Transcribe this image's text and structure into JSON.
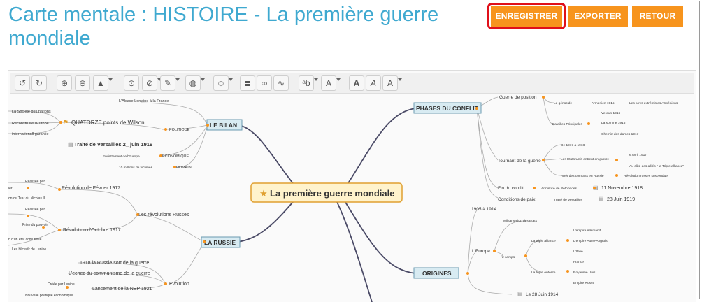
{
  "header": {
    "title": "Carte mentale : HISTOIRE - La première guerre mondiale",
    "save_label": "ENREGISTRER",
    "export_label": "EXPORTER",
    "back_label": "RETOUR"
  },
  "colors": {
    "accent": "#f7941d",
    "title": "#3fa9d0",
    "highlight": "#e0101a",
    "central_fill": "#fff3cc",
    "branch_fill": "#d8ebf2"
  },
  "toolbar": {
    "icons": [
      "undo-icon",
      "redo-icon",
      "zoom-in-icon",
      "zoom-out-icon",
      "shapes-icon",
      "topic-add-icon",
      "topic-remove-icon",
      "pen-color-icon",
      "palette-icon",
      "tag-icon",
      "note-icon",
      "link-icon",
      "relation-icon",
      "font-size-down-icon",
      "font-size-up-icon",
      "bold-icon",
      "italic-icon",
      "font-color-icon"
    ]
  },
  "mindmap": {
    "central": "La première guerre mondiale",
    "branches": {
      "bilan": "LE BILAN",
      "russie": "LA RUSSIE",
      "phases": "PHASES DU CONFLIT",
      "origines": "ORIGINES"
    },
    "bilan": {
      "alsace": "L'Alsace Lorraine à la France",
      "politique": "POLITIQUE",
      "quatorze": "QUATORZE points de Wilson",
      "sdn": "La Société des nations",
      "reconstruire": "Reconstruire l'Europe",
      "inter": "internationall garantie",
      "versailles": "Traité de Versailles 2_ juin 1919",
      "economique": "ECONOMIQUE",
      "endettement": "Endettement de l'Europe",
      "humain": "HUMAIN",
      "victimes": "10 millions de victimes"
    },
    "russie": {
      "revolutions": "Les révolutions Russes",
      "fevrier": "Révolution de Février 1917",
      "realise1": "Réalisée par",
      "r_ier": "ier",
      "tsar": "on du Tsar du Nicolas II",
      "octobre": "Révolution d'Octobre 1917",
      "realise2": "Réalisée par",
      "prise": "Prise du pouvoir",
      "etat": "n d'un état comuniste",
      "bolch": "Les bilcevik de Lenine",
      "evolution": "Evolution",
      "sort": "1918 la Russie sort de la guerre",
      "echec": "L'echec du communisme de la guerre",
      "nep": "Lancement de la NEP 1921",
      "creee": "Créée par Lenine",
      "nouvelle": "Nouvelle politique economique"
    },
    "phases": {
      "guerre_position": "Guerre de position",
      "genocide": "Le génocide",
      "armenien": "Arménien 1915",
      "turcs": "Les turcs extrêmistes Arméniens",
      "batailles": "Batailles Principales",
      "verdun": "Verdun 1916",
      "somme": "La somme 1916",
      "chemin": "Chemin des dames 1917",
      "tournant": "Tournant de la guerre",
      "de1917": "De 1917 à 1918",
      "usa": "Les Etats Unis entrent en guerre",
      "avril": "6 Avril 1917",
      "cote": "Au côté des alliés \" la Triple alliance\"",
      "arret": "Arrêt des combats en Russie",
      "revru": "Révolution russes suspendue",
      "fin": "Fin du conflit",
      "armistice": "Armistice de Rethondes",
      "nov": "11 Novembre 1918",
      "conditions": "Conditions de paix",
      "traite": "Traité de Versailles",
      "juin": "28 Juin 1919"
    },
    "origines": {
      "periode": "1905 à 1914",
      "europe": "L'Europe",
      "militarisation": "Militarisation des Etats",
      "camps": "2 camps",
      "alliance": "La triple alliance",
      "allemand": "L'empire Allemand",
      "austro": "L'empire Autro-Angrois",
      "italie": "L'Italie",
      "entente": "La triple entente",
      "france": "France",
      "royaume": "Royaume Unis",
      "russe": "Empire Russe",
      "le28": "Le 28 Juin 1914"
    }
  }
}
